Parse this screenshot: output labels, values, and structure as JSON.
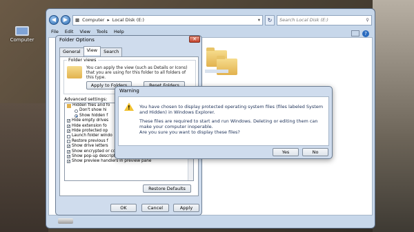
{
  "desktop": {
    "computer_label": "Computer"
  },
  "explorer": {
    "address": [
      "Computer",
      "Local Disk (E:)"
    ],
    "search_placeholder": "Search Local Disk (E:)",
    "menu": [
      "File",
      "Edit",
      "View",
      "Tools",
      "Help"
    ]
  },
  "folder_options": {
    "title": "Folder Options",
    "tabs": [
      "General",
      "View",
      "Search"
    ],
    "active_tab": "View",
    "folder_views": {
      "legend": "Folder views",
      "text": "You can apply the view (such as Details or Icons) that you are using for this folder to all folders of this type.",
      "apply_button": "Apply to Folders",
      "reset_button": "Reset Folders"
    },
    "advanced_label": "Advanced settings:",
    "advanced_items": [
      {
        "kind": "folder",
        "label": "Hidden files and fo"
      },
      {
        "kind": "radio",
        "checked": false,
        "label": "Don't show hi"
      },
      {
        "kind": "radio",
        "checked": true,
        "label": "Show hidden f"
      },
      {
        "kind": "check",
        "checked": true,
        "label": "Hide empty drives"
      },
      {
        "kind": "check",
        "checked": true,
        "label": "Hide extension fo"
      },
      {
        "kind": "check",
        "checked": true,
        "label": "Hide protected op"
      },
      {
        "kind": "check",
        "checked": false,
        "label": "Launch folder windo"
      },
      {
        "kind": "check",
        "checked": false,
        "label": "Restore previous f"
      },
      {
        "kind": "check",
        "checked": true,
        "label": "Show drive letters"
      },
      {
        "kind": "check",
        "checked": true,
        "label": "Show encrypted or compressed NTFS files in color"
      },
      {
        "kind": "check",
        "checked": true,
        "label": "Show pop-up description for folder and desktop items"
      },
      {
        "kind": "check",
        "checked": true,
        "label": "Show preview handlers in preview pane"
      }
    ],
    "restore_button": "Restore Defaults",
    "ok_button": "OK",
    "cancel_button": "Cancel",
    "apply_button": "Apply"
  },
  "warning": {
    "title": "Warning",
    "message_1": "You have chosen to display protected operating system files (files labeled System and Hidden) in Windows Explorer.",
    "message_2": "These files are required to start and run Windows. Deleting or editing them can make your computer inoperable.",
    "message_3": "Are you sure you want to display these files?",
    "yes_button": "Yes",
    "no_button": "No"
  }
}
